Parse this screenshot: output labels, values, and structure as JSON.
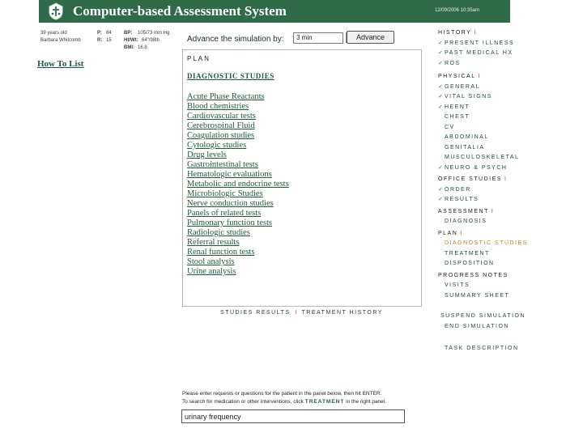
{
  "header": {
    "title": "Computer-based Assessment System",
    "datetime": "12/09/2006 10:35am"
  },
  "patient": {
    "age": "39 years old",
    "name": "Barbara Whitcomb",
    "p_label": "P:",
    "p_value": "84",
    "r_label": "R:",
    "r_value": "15",
    "bp_label": "BP:",
    "bp_value": "105/73 mm Hg",
    "htwt_label": "Ht/Wt:",
    "htwt_value": "64\"/98lb",
    "bmi_label": "BMI:",
    "bmi_value": "16.8"
  },
  "how_to_list": "How To List",
  "advance": {
    "label": "Advance the simulation by:",
    "selected": "3 min",
    "button": "Advance"
  },
  "plan": {
    "title": "PLAN",
    "heading": "DIAGNOSTIC STUDIES",
    "studies": [
      "Acute Phase Reactants",
      "Blood chemistries",
      "Cardiovascular tests",
      "Cerebrospinal Fluid",
      "Coagulation studies",
      "Cytologic studies",
      "Drug levels",
      "Gastrointestinal tests",
      "Hematologic evaluations",
      "Metabolic and endocrine tests",
      "Microbiologic Studies",
      "Nerve conduction studies",
      "Panels of related tests",
      "Pulmonary function tests",
      "Radiologic studies",
      "Referral results",
      "Renal function tests",
      "Stool analysis",
      "Urine analysis"
    ]
  },
  "panel_tabs": {
    "studies_results": "STUDIES RESULTS",
    "treatment_history": "TREATMENT HISTORY"
  },
  "nav": {
    "history": "HISTORY",
    "present_illness": "PRESENT ILLNESS",
    "past_medical_hx": "PAST MEDICAL HX",
    "ros": "ROS",
    "physical": "PHYSICAL",
    "general": "GENERAL",
    "vital_signs": "VITAL SIGNS",
    "heent": "HEENT",
    "chest": "CHEST",
    "cv": "CV",
    "abdominal": "ABDOMINAL",
    "genitalia": "GENITALIA",
    "musculoskeletal": "MUSCULOSKELETAL",
    "neuro_psych": "NEURO & PSYCH",
    "office_studies": "OFFICE STUDIES",
    "order": "ORDER",
    "results": "RESULTS",
    "assessment": "ASSESSMENT",
    "diagnosis": "DIAGNOSIS",
    "plan": "PLAN",
    "diagnostic_studies": "DIAGNOSTIC STUDIES",
    "treatment": "TREATMENT",
    "disposition": "DISPOSITION",
    "progress_notes": "PROGRESS NOTES",
    "visits": "VISITS",
    "summary_sheet": "SUMMARY SHEET",
    "suspend_simulation": "SUSPEND SIMULATION",
    "end_simulation": "END SIMULATION",
    "task_description": "TASK DESCRIPTION",
    "pipe": "I",
    "check": "✓"
  },
  "request": {
    "instruction1": "Please enter requests or questions for the patient in the panel below, then hit ENTER.",
    "instruction2a": "To search for medication or other interventions, click",
    "instruction2b": "TREATMENT",
    "instruction2c": "in the right panel.",
    "value": "urinary frequency"
  },
  "colors": {
    "header_bg": "#2f6b48",
    "link": "#1f5b3a",
    "current_nav": "#d07a1c",
    "separator": "#c0392b"
  }
}
